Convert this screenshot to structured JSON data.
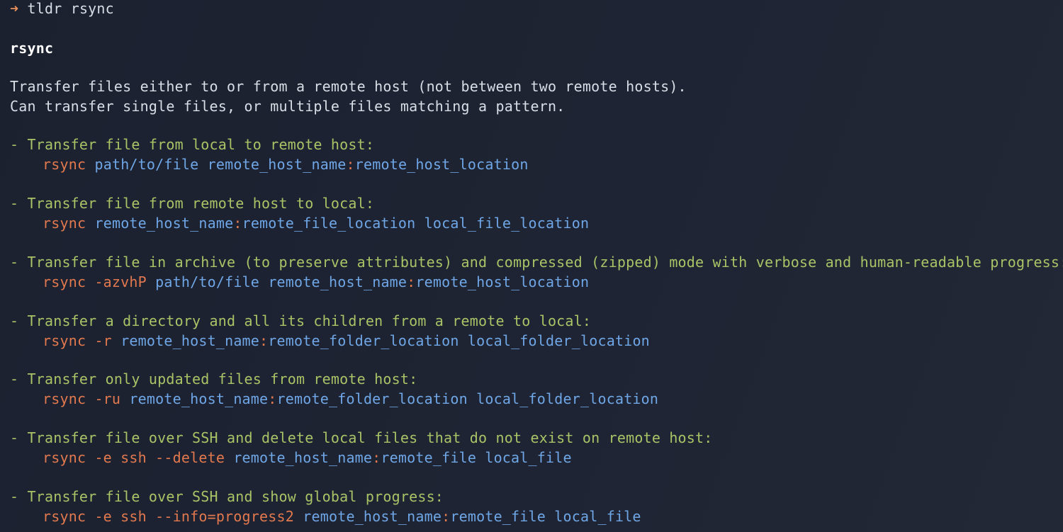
{
  "prompt": {
    "arrow": "➜",
    "command": "tldr rsync"
  },
  "page_title": "rsync",
  "description": [
    "Transfer files either to or from a remote host (not between two remote hosts).",
    "Can transfer single files, or multiple files matching a pattern."
  ],
  "examples": [
    {
      "desc": "- Transfer file from local to remote host:",
      "cmd": "rsync",
      "a1": "path/to/file",
      "host": "remote_host_name",
      "colon": ":",
      "a2": "remote_host_location",
      "a3": ""
    },
    {
      "desc": "- Transfer file from remote host to local:",
      "cmd": "rsync",
      "a1": "",
      "host": "remote_host_name",
      "colon": ":",
      "a2": "remote_file_location",
      "a3": "local_file_location"
    },
    {
      "desc": "- Transfer file in archive (to preserve attributes) and compressed (zipped) mode with verbose and human-readable progress:",
      "cmd": "rsync -azvhP",
      "a1": "path/to/file",
      "host": "remote_host_name",
      "colon": ":",
      "a2": "remote_host_location",
      "a3": ""
    },
    {
      "desc": "- Transfer a directory and all its children from a remote to local:",
      "cmd": "rsync -r",
      "a1": "",
      "host": "remote_host_name",
      "colon": ":",
      "a2": "remote_folder_location",
      "a3": "local_folder_location"
    },
    {
      "desc": "- Transfer only updated files from remote host:",
      "cmd": "rsync -ru",
      "a1": "",
      "host": "remote_host_name",
      "colon": ":",
      "a2": "remote_folder_location",
      "a3": "local_folder_location"
    },
    {
      "desc": "- Transfer file over SSH and delete local files that do not exist on remote host:",
      "cmd": "rsync -e ssh --delete",
      "a1": "",
      "host": "remote_host_name",
      "colon": ":",
      "a2": "remote_file",
      "a3": "local_file"
    },
    {
      "desc": "- Transfer file over SSH and show global progress:",
      "cmd": "rsync -e ssh --info=progress2",
      "a1": "",
      "host": "remote_host_name",
      "colon": ":",
      "a2": "remote_file",
      "a3": "local_file"
    }
  ],
  "colors": {
    "background": "#1d2230",
    "text": "#d9dde6",
    "example_desc": "#a8c466",
    "command": "#e2794e",
    "argument": "#6fa6e6"
  }
}
